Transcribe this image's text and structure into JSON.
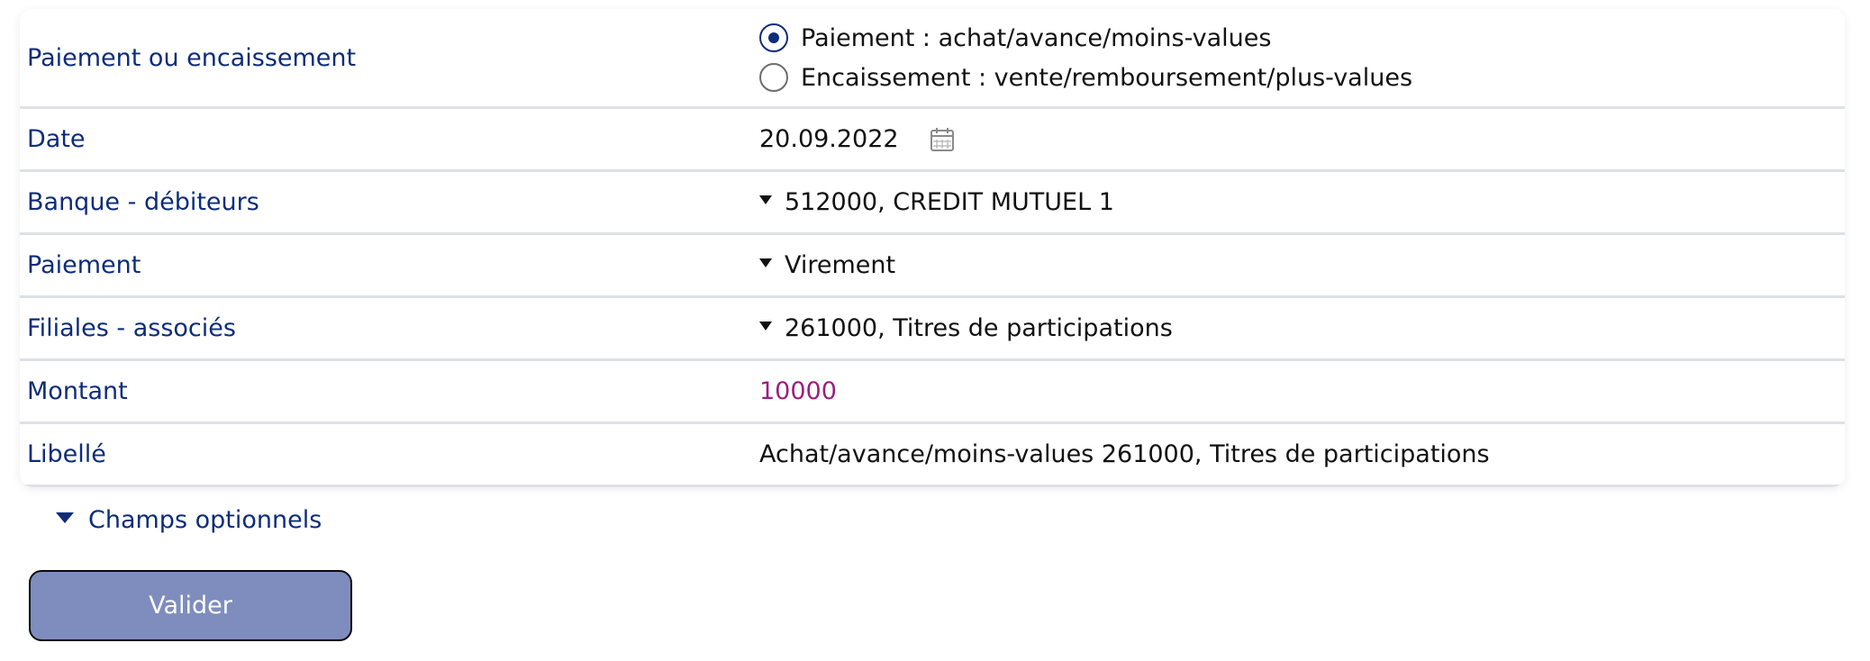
{
  "form": {
    "rows": [
      {
        "label": "Paiement ou encaissement",
        "options": [
          {
            "label": "Paiement : achat/avance/moins-values",
            "selected": true
          },
          {
            "label": "Encaissement : vente/remboursement/plus-values",
            "selected": false
          }
        ]
      },
      {
        "label": "Date",
        "value": "20.09.2022"
      },
      {
        "label": "Banque - débiteurs",
        "value": "512000, CREDIT MUTUEL 1"
      },
      {
        "label": "Paiement",
        "value": "Virement"
      },
      {
        "label": "Filiales - associés",
        "value": "261000, Titres de participations"
      },
      {
        "label": "Montant",
        "value": "10000"
      },
      {
        "label": "Libellé",
        "value": "Achat/avance/moins-values 261000, Titres de participations"
      }
    ]
  },
  "optional": {
    "label": "Champs optionnels"
  },
  "actions": {
    "validate_label": "Valider"
  },
  "icons": {
    "calendar": "calendar-icon",
    "dropdown": "chevron-down-icon",
    "disclosure": "caret-down-icon"
  },
  "colors": {
    "label": "#0d2d7a",
    "text": "#111111",
    "amount": "#9b1f80",
    "button_bg": "#7f8dbe",
    "button_text": "#ffffff",
    "divider": "#dde1e6"
  }
}
